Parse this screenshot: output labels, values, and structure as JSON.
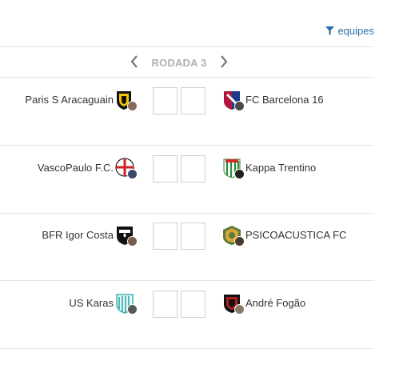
{
  "filter": {
    "label": "equipes",
    "icon": "filter-icon",
    "color": "#2a6fa8"
  },
  "round": {
    "label": "RODADA 3"
  },
  "matches": [
    {
      "home": "Paris S Aracaguain",
      "away": "FC Barcelona 16"
    },
    {
      "home": "VascoPaulo F.C.",
      "away": "Kappa Trentino"
    },
    {
      "home": "BFR Igor Costa",
      "away": "PSICOACUSTICA FC"
    },
    {
      "home": "US Karas",
      "away": "André Fogão"
    }
  ]
}
